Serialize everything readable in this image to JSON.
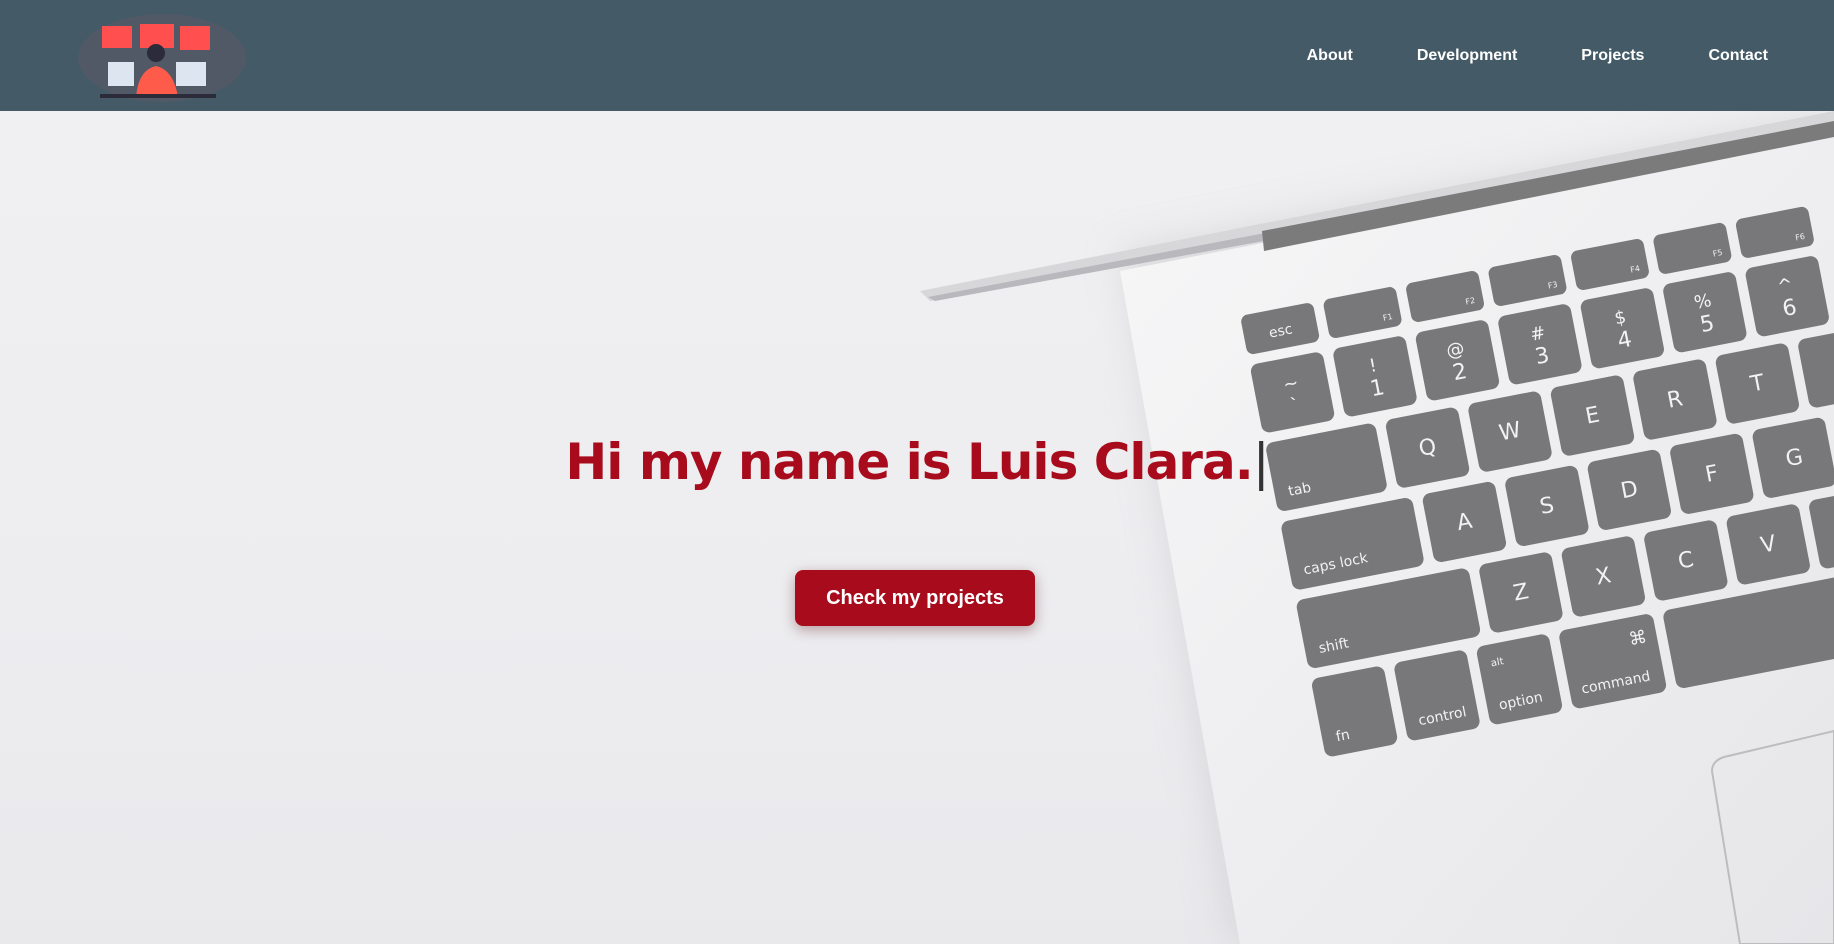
{
  "nav": {
    "links": [
      "About",
      "Development",
      "Projects",
      "Contact"
    ]
  },
  "hero": {
    "headline": "Hi my name is Luis Clara.",
    "cursor": "|",
    "cta_label": "Check my projects"
  },
  "keyboard": {
    "fn_row": [
      "esc",
      "F1",
      "F2",
      "F3",
      "F4",
      "F5",
      "F6"
    ],
    "number_row": [
      [
        "~",
        "`"
      ],
      [
        "!",
        "1"
      ],
      [
        "@",
        "2"
      ],
      [
        "#",
        "3"
      ],
      [
        "$",
        "4"
      ],
      [
        "%",
        "5"
      ],
      [
        "^",
        "6"
      ]
    ],
    "qwerty_row": [
      "tab",
      "Q",
      "W",
      "E",
      "R",
      "T"
    ],
    "home_row": [
      "caps lock",
      "A",
      "S",
      "D",
      "F",
      "G"
    ],
    "shift_row": [
      "shift",
      "Z",
      "X",
      "C",
      "V"
    ],
    "bottom_row": [
      "fn",
      "control",
      "alt",
      "option",
      "⌘",
      "command"
    ]
  },
  "colors": {
    "navbar": "#445a66",
    "accent": "#a80c1c",
    "background": "#eeeef0"
  }
}
